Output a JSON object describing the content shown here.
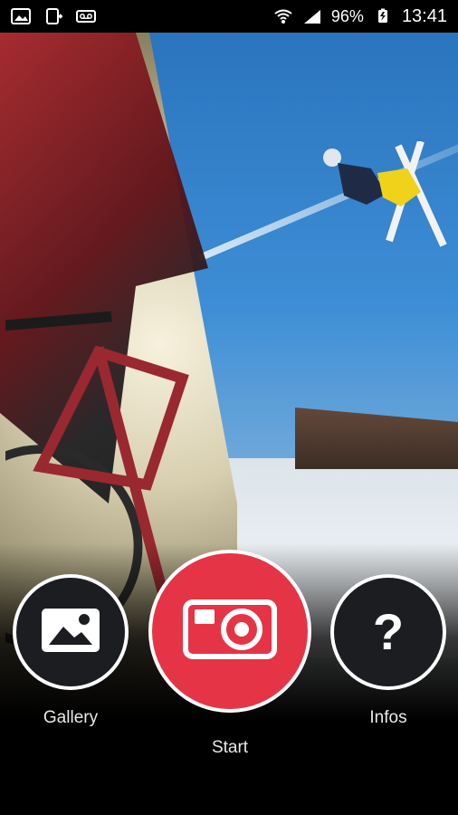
{
  "status_bar": {
    "battery": "96%",
    "time": "13:41",
    "icons": [
      "gallery-icon",
      "device-sync-icon",
      "voicemail-icon",
      "wifi-icon",
      "signal-icon",
      "battery-icon"
    ]
  },
  "actions": {
    "gallery": {
      "label": "Gallery",
      "icon": "image-icon"
    },
    "start": {
      "label": "Start",
      "icon": "camera-icon"
    },
    "infos": {
      "label": "Infos",
      "icon": "question-icon"
    }
  },
  "colors": {
    "start_button": "#e53445",
    "dark_button": "#1b1d21",
    "text": "#e8e8e8"
  }
}
